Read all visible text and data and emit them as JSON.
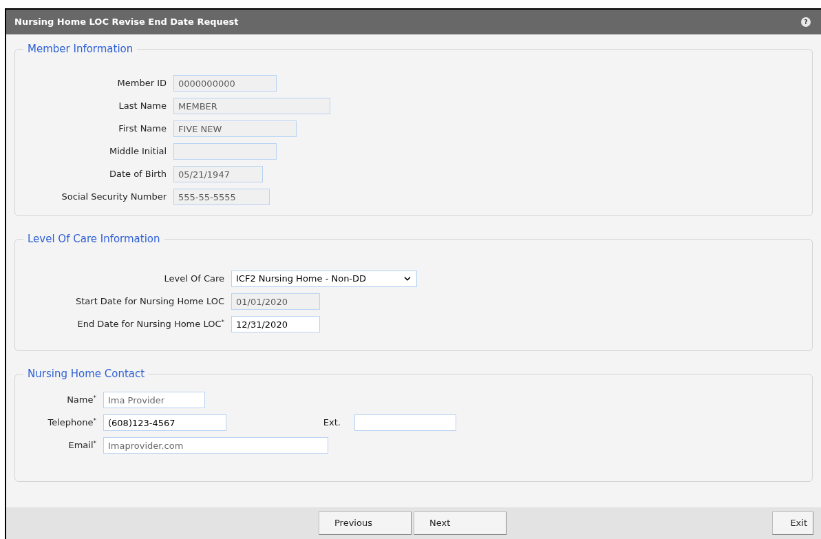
{
  "window": {
    "title": "Nursing Home LOC Revise End Date Request",
    "help": "?"
  },
  "sections": [
    {
      "title": "Member Information",
      "kind": "member",
      "fields": [
        {
          "label": "Member ID",
          "kind": "readonly",
          "value": "0000000000"
        },
        {
          "label": "Last Name",
          "kind": "readonly",
          "value": "MEMBER"
        },
        {
          "label": "First Name",
          "kind": "readonly",
          "value": "FIVE NEW"
        },
        {
          "label": "Middle Initial",
          "kind": "readonly"
        },
        {
          "label": "Date of Birth",
          "kind": "readonly",
          "value": "05/21/1947"
        },
        {
          "label": "Social Security Number",
          "kind": "readonly",
          "value": "555-55-5555"
        }
      ]
    },
    {
      "title": "Level Of Care Information",
      "kind": "loc",
      "fields": [
        {
          "label": "Level Of Care",
          "kind": "select",
          "value": "ICF2 Nursing Home - Non-DD"
        },
        {
          "label": "Start Date for Nursing Home LOC",
          "kind": "readonly",
          "value": "01/01/2020"
        },
        {
          "label": "End Date for Nursing Home LOC$^{*}$",
          "kind": "input",
          "value": "12/31/2020"
        }
      ]
    },
    {
      "title": "Nursing Home Contact",
      "kind": "contact",
      "fields": [
        {
          "label": "Name$^{*}$",
          "kind": "input",
          "placeholder": "Ima Provider"
        },
        {
          "label": "Telephone$^{*}$",
          "kind": "input",
          "value": "(608)123-4567"
        },
        {
          "label": "Ext.",
          "kind": "input"
        },
        {
          "label": "Email$^{*}$",
          "kind": "input",
          "placeholder": "Imaprovider.com"
        }
      ]
    }
  ],
  "footer": {
    "buttons": [
      "Previous",
      "Next"
    ],
    "exit": "Exit"
  }
}
